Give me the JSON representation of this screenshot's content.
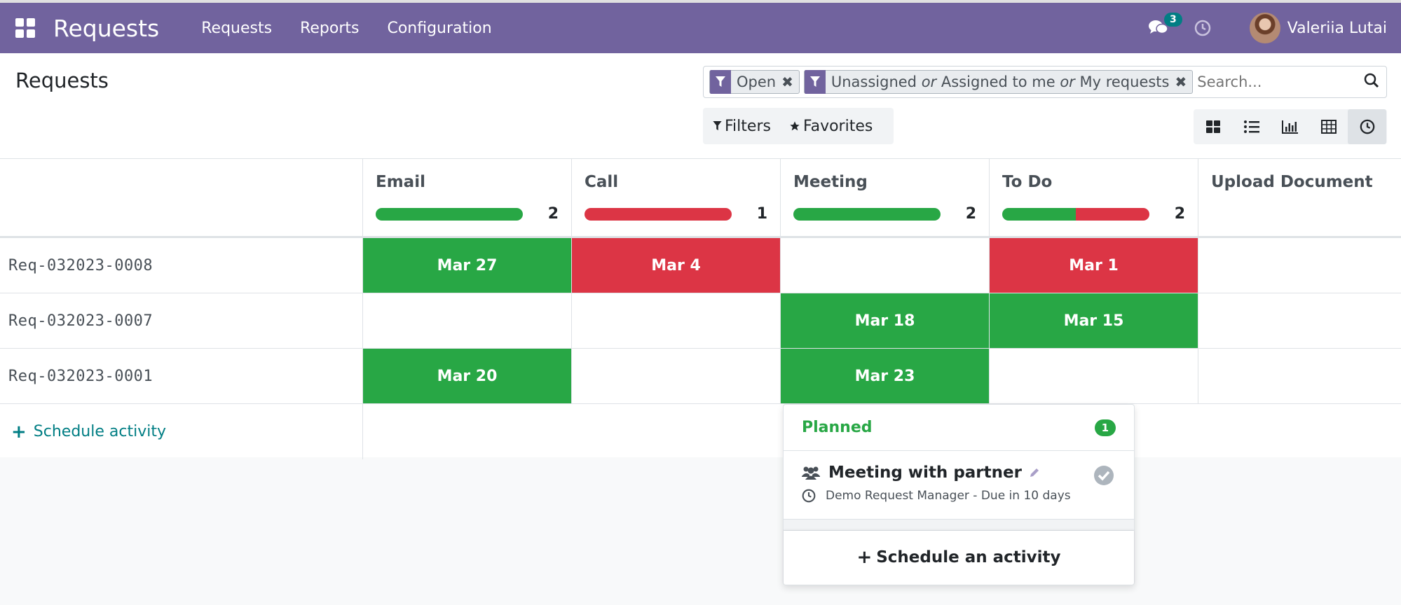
{
  "navbar": {
    "brand": "Requests",
    "menu": [
      "Requests",
      "Reports",
      "Configuration"
    ],
    "messages_count": "3",
    "user_name": "Valeriia Lutai"
  },
  "control_panel": {
    "title": "Requests",
    "facets": [
      {
        "text": "Open"
      },
      {
        "parts": [
          "Unassigned ",
          "or",
          " Assigned to me ",
          "or",
          " My requests"
        ]
      }
    ],
    "search_placeholder": "Search...",
    "filters_label": "Filters",
    "favorites_label": "Favorites",
    "views": [
      "kanban-view",
      "list-view",
      "graph-view",
      "pivot-view",
      "activity-view"
    ],
    "active_view": "activity-view"
  },
  "activity_grid": {
    "columns": [
      {
        "title": "Email",
        "count": "2",
        "green": 1.0,
        "red": 0.0
      },
      {
        "title": "Call",
        "count": "1",
        "green": 0.0,
        "red": 1.0
      },
      {
        "title": "Meeting",
        "count": "2",
        "green": 1.0,
        "red": 0.0
      },
      {
        "title": "To Do",
        "count": "2",
        "green": 0.5,
        "red": 0.5
      },
      {
        "title": "Upload Document",
        "count": "",
        "green": 0,
        "red": 0
      }
    ],
    "rows": [
      {
        "record": "Req-032023-0008",
        "cells": [
          {
            "text": "Mar 27",
            "state": "green"
          },
          {
            "text": "Mar 4",
            "state": "red"
          },
          {
            "text": "",
            "state": ""
          },
          {
            "text": "Mar 1",
            "state": "red"
          },
          {
            "text": "",
            "state": ""
          }
        ]
      },
      {
        "record": "Req-032023-0007",
        "cells": [
          {
            "text": "",
            "state": ""
          },
          {
            "text": "",
            "state": ""
          },
          {
            "text": "Mar 18",
            "state": "green"
          },
          {
            "text": "Mar 15",
            "state": "green"
          },
          {
            "text": "",
            "state": ""
          }
        ]
      },
      {
        "record": "Req-032023-0001",
        "cells": [
          {
            "text": "Mar 20",
            "state": "green"
          },
          {
            "text": "",
            "state": ""
          },
          {
            "text": "Mar 23",
            "state": "green"
          },
          {
            "text": "",
            "state": ""
          },
          {
            "text": "",
            "state": ""
          }
        ]
      }
    ],
    "schedule_label": "Schedule activity"
  },
  "popover": {
    "section_title": "Planned",
    "section_count": "1",
    "activity_name": "Meeting with partner",
    "activity_meta": "Demo Request Manager - Due in 10 days",
    "footer_label": "Schedule an activity"
  },
  "colors": {
    "navbar": "#71639e",
    "green": "#28a745",
    "red": "#dc3545",
    "teal": "#017e84"
  }
}
